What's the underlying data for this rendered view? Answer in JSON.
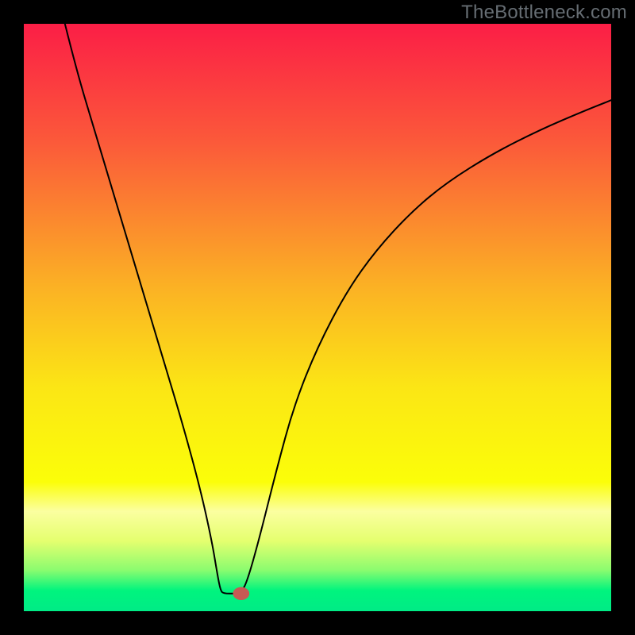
{
  "watermark": "TheBottleneck.com",
  "chart_data": {
    "type": "line",
    "title": "",
    "xlabel": "",
    "ylabel": "",
    "xlim": [
      0,
      100
    ],
    "ylim": [
      0,
      100
    ],
    "background": {
      "type": "vertical-gradient",
      "stops": [
        {
          "offset": 0.0,
          "color": "#fb1e46"
        },
        {
          "offset": 0.2,
          "color": "#fb593a"
        },
        {
          "offset": 0.45,
          "color": "#fbb224"
        },
        {
          "offset": 0.62,
          "color": "#fbe615"
        },
        {
          "offset": 0.78,
          "color": "#fbfe09"
        },
        {
          "offset": 0.83,
          "color": "#fbffa0"
        },
        {
          "offset": 0.88,
          "color": "#e5ff6f"
        },
        {
          "offset": 0.93,
          "color": "#8bfc6f"
        },
        {
          "offset": 0.965,
          "color": "#00f47e"
        },
        {
          "offset": 1.0,
          "color": "#00eb86"
        }
      ]
    },
    "series": [
      {
        "name": "curve",
        "type": "line",
        "color": "#000000",
        "width": 2,
        "points": [
          {
            "x": 7.0,
            "y": 100.0
          },
          {
            "x": 9.0,
            "y": 92.0
          },
          {
            "x": 12.0,
            "y": 82.0
          },
          {
            "x": 15.0,
            "y": 72.0
          },
          {
            "x": 18.0,
            "y": 62.0
          },
          {
            "x": 21.0,
            "y": 52.0
          },
          {
            "x": 24.0,
            "y": 42.0
          },
          {
            "x": 27.0,
            "y": 32.0
          },
          {
            "x": 30.0,
            "y": 21.0
          },
          {
            "x": 32.0,
            "y": 12.0
          },
          {
            "x": 33.0,
            "y": 6.0
          },
          {
            "x": 33.5,
            "y": 3.5
          },
          {
            "x": 34.0,
            "y": 3.0
          },
          {
            "x": 36.0,
            "y": 3.0
          },
          {
            "x": 37.0,
            "y": 3.2
          },
          {
            "x": 38.0,
            "y": 5.0
          },
          {
            "x": 40.0,
            "y": 12.0
          },
          {
            "x": 43.0,
            "y": 24.0
          },
          {
            "x": 46.0,
            "y": 35.0
          },
          {
            "x": 50.0,
            "y": 45.0
          },
          {
            "x": 55.0,
            "y": 54.5
          },
          {
            "x": 60.0,
            "y": 61.5
          },
          {
            "x": 66.0,
            "y": 68.0
          },
          {
            "x": 72.0,
            "y": 73.0
          },
          {
            "x": 80.0,
            "y": 78.0
          },
          {
            "x": 88.0,
            "y": 82.0
          },
          {
            "x": 95.0,
            "y": 85.0
          },
          {
            "x": 100.0,
            "y": 87.0
          }
        ]
      }
    ],
    "marker": {
      "x": 37.0,
      "y": 3.0,
      "rx": 1.4,
      "ry": 1.1,
      "color": "#c65a54"
    }
  }
}
